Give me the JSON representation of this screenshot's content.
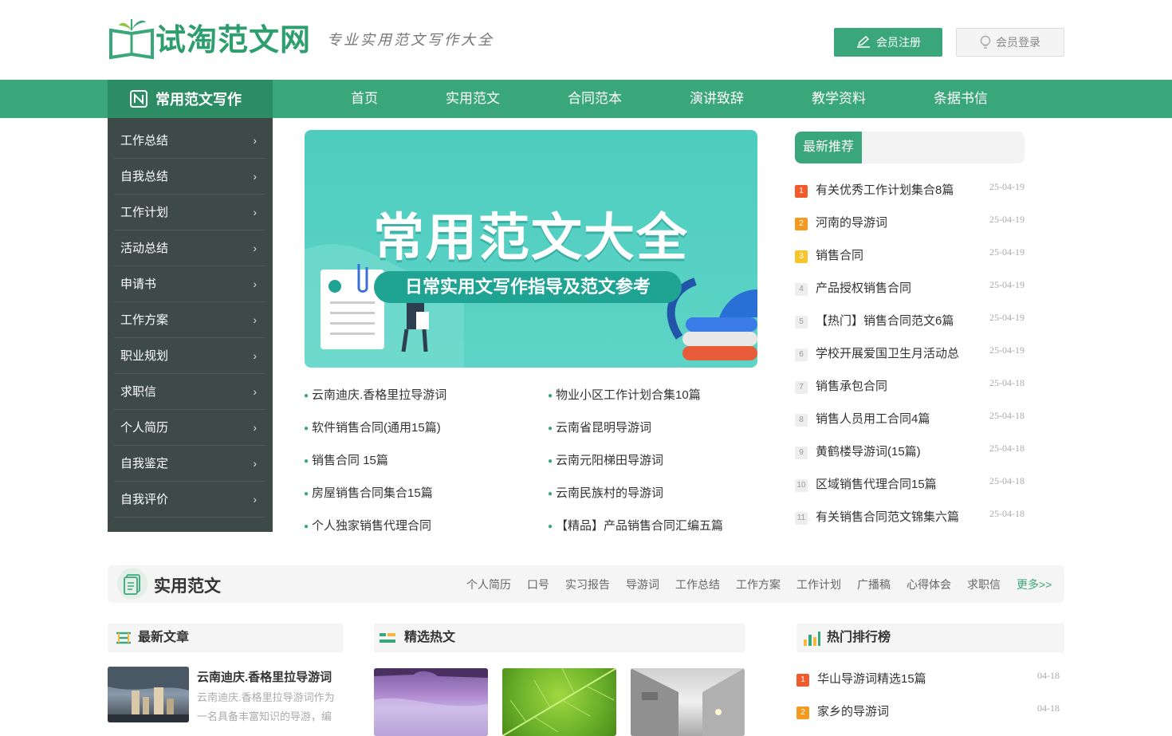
{
  "header": {
    "logo_text": "试淘范文网",
    "slogan": "专业实用范文写作大全",
    "register_label": "会员注册",
    "login_label": "会员登录"
  },
  "nav": {
    "brand": "常用范文写作",
    "links": [
      "首页",
      "实用范文",
      "合同范本",
      "演讲致辞",
      "教学资料",
      "条据书信"
    ]
  },
  "sidebar": {
    "items": [
      "工作总结",
      "自我总结",
      "工作计划",
      "活动总结",
      "申请书",
      "工作方案",
      "职业规划",
      "求职信",
      "个人简历",
      "自我鉴定",
      "自我评价"
    ]
  },
  "banner": {
    "title": "常用范文大全",
    "subtitle": "日常实用文写作指导及范文参考"
  },
  "articles": {
    "left": [
      "云南迪庆.香格里拉导游词",
      "软件销售合同(通用15篇)",
      "销售合同 15篇",
      "房屋销售合同集合15篇",
      "个人独家销售代理合同"
    ],
    "right": [
      "物业小区工作计划合集10篇",
      "云南省昆明导游词",
      "云南元阳梯田导游词",
      "云南民族村的导游词",
      "【精品】产品销售合同汇编五篇"
    ]
  },
  "recommend": {
    "tab": "最新推荐",
    "items": [
      {
        "n": "1",
        "title": "有关优秀工作计划集合8篇",
        "date": "25-04-19"
      },
      {
        "n": "2",
        "title": "河南的导游词",
        "date": "25-04-19"
      },
      {
        "n": "3",
        "title": "销售合同",
        "date": "25-04-19"
      },
      {
        "n": "4",
        "title": "产品授权销售合同",
        "date": "25-04-19"
      },
      {
        "n": "5",
        "title": "【热门】销售合同范文6篇",
        "date": "25-04-19"
      },
      {
        "n": "6",
        "title": "学校开展爱国卫生月活动总",
        "date": "25-04-19"
      },
      {
        "n": "7",
        "title": "销售承包合同",
        "date": "25-04-18"
      },
      {
        "n": "8",
        "title": "销售人员用工合同4篇",
        "date": "25-04-18"
      },
      {
        "n": "9",
        "title": "黄鹤楼导游词(15篇)",
        "date": "25-04-18"
      },
      {
        "n": "10",
        "title": "区域销售代理合同15篇",
        "date": "25-04-18"
      },
      {
        "n": "11",
        "title": "有关销售合同范文锦集六篇",
        "date": "25-04-18"
      }
    ]
  },
  "section": {
    "title": "实用范文",
    "links": [
      "个人简历",
      "口号",
      "实习报告",
      "导游词",
      "工作总结",
      "工作方案",
      "工作计划",
      "广播稿",
      "心得体会",
      "求职信"
    ],
    "more": "更多>>"
  },
  "latest": {
    "heading": "最新文章",
    "article_title": "云南迪庆.香格里拉导游词",
    "article_excerpt_1": "云南迪庆.香格里拉导游词作为",
    "article_excerpt_2": "一名具备丰富知识的导游，编"
  },
  "hot": {
    "heading": "精选热文"
  },
  "ranking": {
    "heading": "热门排行榜",
    "items": [
      {
        "n": "1",
        "title": "华山导游词精选15篇",
        "date": "04-18"
      },
      {
        "n": "2",
        "title": "家乡的导游词",
        "date": "04-18"
      }
    ]
  },
  "colors": {
    "brand_green": "#3aa77a",
    "dark_green": "#2c8d64",
    "sidebar_bg": "#3d4a47",
    "banner_teal": "#4ecdbf"
  }
}
